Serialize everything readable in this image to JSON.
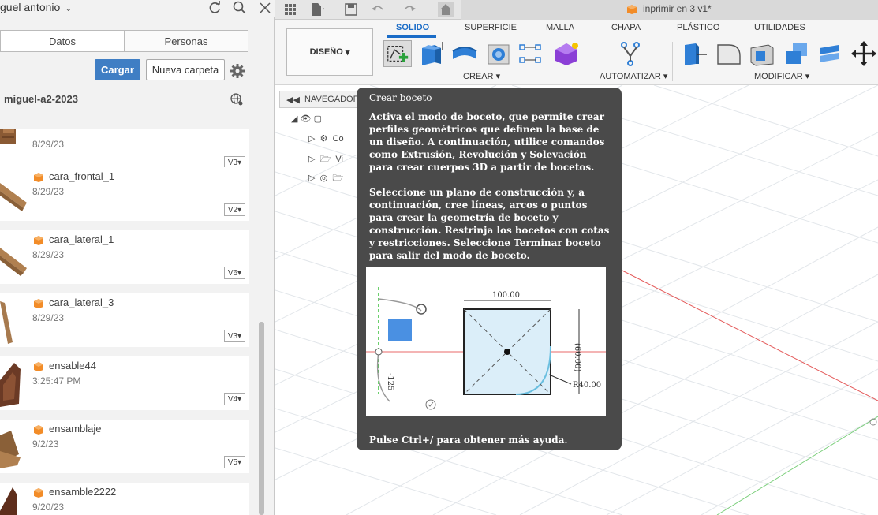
{
  "data_panel": {
    "username": "guel antonio",
    "tabs": [
      "Datos",
      "Personas"
    ],
    "upload_label": "Cargar",
    "new_folder_label": "Nueva carpeta",
    "project_name": "miguel-a2-2023",
    "files": [
      {
        "name": "",
        "date": "8/29/23",
        "version": "V3"
      },
      {
        "name": "cara_frontal_1",
        "date": "8/29/23",
        "version": "V2"
      },
      {
        "name": "cara_lateral_1",
        "date": "8/29/23",
        "version": "V6"
      },
      {
        "name": "cara_lateral_3",
        "date": "8/29/23",
        "version": "V3"
      },
      {
        "name": "ensable44",
        "date": "3:25:47 PM",
        "version": "V4"
      },
      {
        "name": "ensamblaje",
        "date": "9/2/23",
        "version": "V5"
      },
      {
        "name": "ensamble2222",
        "date": "9/20/23",
        "version": ""
      }
    ]
  },
  "app": {
    "document_title": "inprimir en 3 v1*",
    "workspace_label": "DISEÑO",
    "workspace_tabs": [
      "SOLIDO",
      "SUPERFICIE",
      "MALLA",
      "CHAPA",
      "PLÁSTICO",
      "UTILIDADES"
    ],
    "groups": {
      "create": "CREAR",
      "automate": "AUTOMATIZAR",
      "modify": "MODIFICAR"
    }
  },
  "navigator": {
    "label": "NAVEGADOR",
    "rows": [
      "Co",
      "Vi"
    ]
  },
  "tooltip": {
    "title": "Crear boceto",
    "para1": "Activa el modo de boceto, que permite crear perfiles geométricos que definen la base de un diseño. A continuación, utilice comandos como Extrusión, Revolución y Solevación para crear cuerpos 3D a partir de bocetos.",
    "para2": "Seleccione un plano de construcción y, a continuación, cree líneas, arcos o puntos para crear la geometría de boceto y construcción. Restrinja los bocetos con cotas y restricciones. Seleccione Terminar boceto para salir del modo de boceto.",
    "footer": "Pulse Ctrl+/ para obtener más ayuda.",
    "diagram": {
      "dim_top": "100.00",
      "dim_right": "(60.00)",
      "dim_left": "-125",
      "dim_radius": "R40.00"
    }
  },
  "colors": {
    "accent_blue": "#1a6cc7",
    "button_blue": "#3f7ec4",
    "tooltip_bg": "#4a4a4a",
    "file_icon_orange": "#f28c28"
  }
}
